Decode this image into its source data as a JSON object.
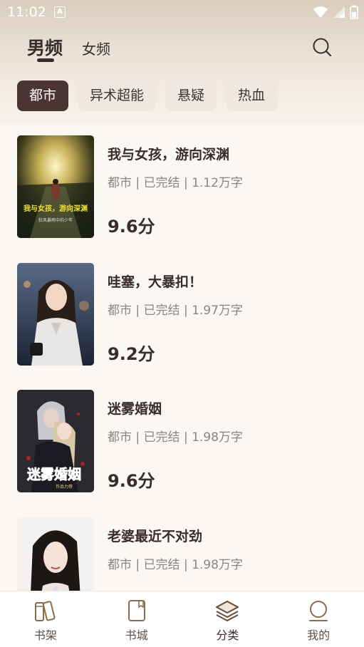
{
  "status_bar": {
    "time": "11:02",
    "notification_icon_letter": "A"
  },
  "header": {
    "gender_tabs": [
      {
        "label": "男频",
        "active": true
      },
      {
        "label": "女频",
        "active": false
      }
    ],
    "search_icon": "search-icon"
  },
  "categories": [
    {
      "label": "都市",
      "active": true
    },
    {
      "label": "异术超能",
      "active": false
    },
    {
      "label": "悬疑",
      "active": false
    },
    {
      "label": "热血",
      "active": false
    }
  ],
  "books": [
    {
      "title": "我与女孩，游向深渊",
      "meta": "都市 | 已完结 | 1.12万字",
      "score": "9.6分",
      "cover_text": "我与女孩，游向深渊",
      "cover_subtext": "狂风暴雨中的少年"
    },
    {
      "title": "哇塞，大暴扣！",
      "meta": "都市 | 已完结 | 1.97万字",
      "score": "9.2分"
    },
    {
      "title": "迷雾婚姻",
      "meta": "都市 | 已完结 | 1.98万字",
      "score": "9.6分",
      "cover_text": "迷雾婚姻",
      "cover_subtext": "作品力荐"
    },
    {
      "title": "老婆最近不对劲",
      "meta": "都市 | 已完结 | 1.98万字",
      "score": ""
    }
  ],
  "bottom_nav": [
    {
      "label": "书架",
      "icon": "bookshelf-icon",
      "active": false
    },
    {
      "label": "书城",
      "icon": "book-icon",
      "active": false
    },
    {
      "label": "分类",
      "icon": "layers-icon",
      "active": true
    },
    {
      "label": "我的",
      "icon": "profile-icon",
      "active": false
    }
  ],
  "colors": {
    "accent": "#4a3434",
    "text_primary": "#3a2c2a",
    "text_secondary": "#8c8480",
    "chip_bg": "#efe8de",
    "background": "#fbf8f3"
  }
}
